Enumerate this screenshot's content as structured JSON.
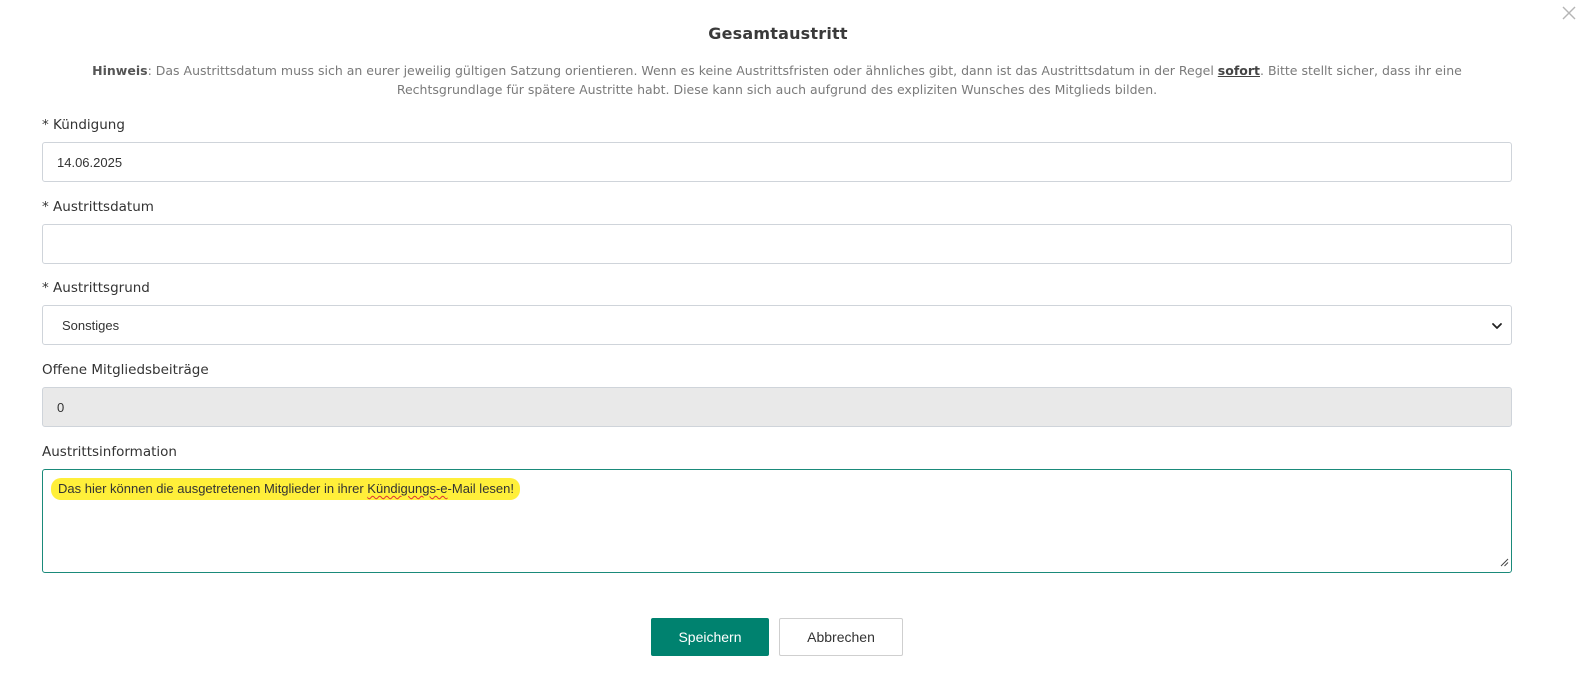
{
  "modal": {
    "title": "Gesamtaustritt",
    "hint": {
      "label": "Hinweis",
      "text_before": ": Das Austrittsdatum muss sich an eurer jeweilig gültigen Satzung orientieren. Wenn es keine Austrittsfristen oder ähnliches gibt, dann ist das Austrittsdatum in der Regel ",
      "emphasis": "sofort",
      "text_after": ". Bitte stellt sicher, dass ihr eine Rechtsgrundlage für spätere Austritte habt. Diese kann sich auch aufgrund des expliziten Wunsches des Mitglieds bilden."
    }
  },
  "form": {
    "kuendigung": {
      "label": "* Kündigung",
      "value": "14.06.2025"
    },
    "austrittsdatum": {
      "label": "* Austrittsdatum",
      "value": ""
    },
    "austrittsgrund": {
      "label": "* Austrittsgrund",
      "selected": "Sonstiges"
    },
    "offene_beitraege": {
      "label": "Offene Mitgliedsbeiträge",
      "value": "0"
    },
    "austrittsinformation": {
      "label": "Austrittsinformation",
      "text_before": "Das hier können die ausgetretenen Mitglieder in ihrer ",
      "misspelled": "Kündigungs-e",
      "text_after": "-Mail lesen!"
    }
  },
  "buttons": {
    "save": "Speichern",
    "cancel": "Abbrechen"
  },
  "colors": {
    "primary": "#00826f",
    "highlight": "#ffef3a",
    "focus_border": "#1a8a7a"
  },
  "icons": {
    "close": "close-icon",
    "select": "chevron-down-icon",
    "resize": "resize-handle-icon"
  }
}
